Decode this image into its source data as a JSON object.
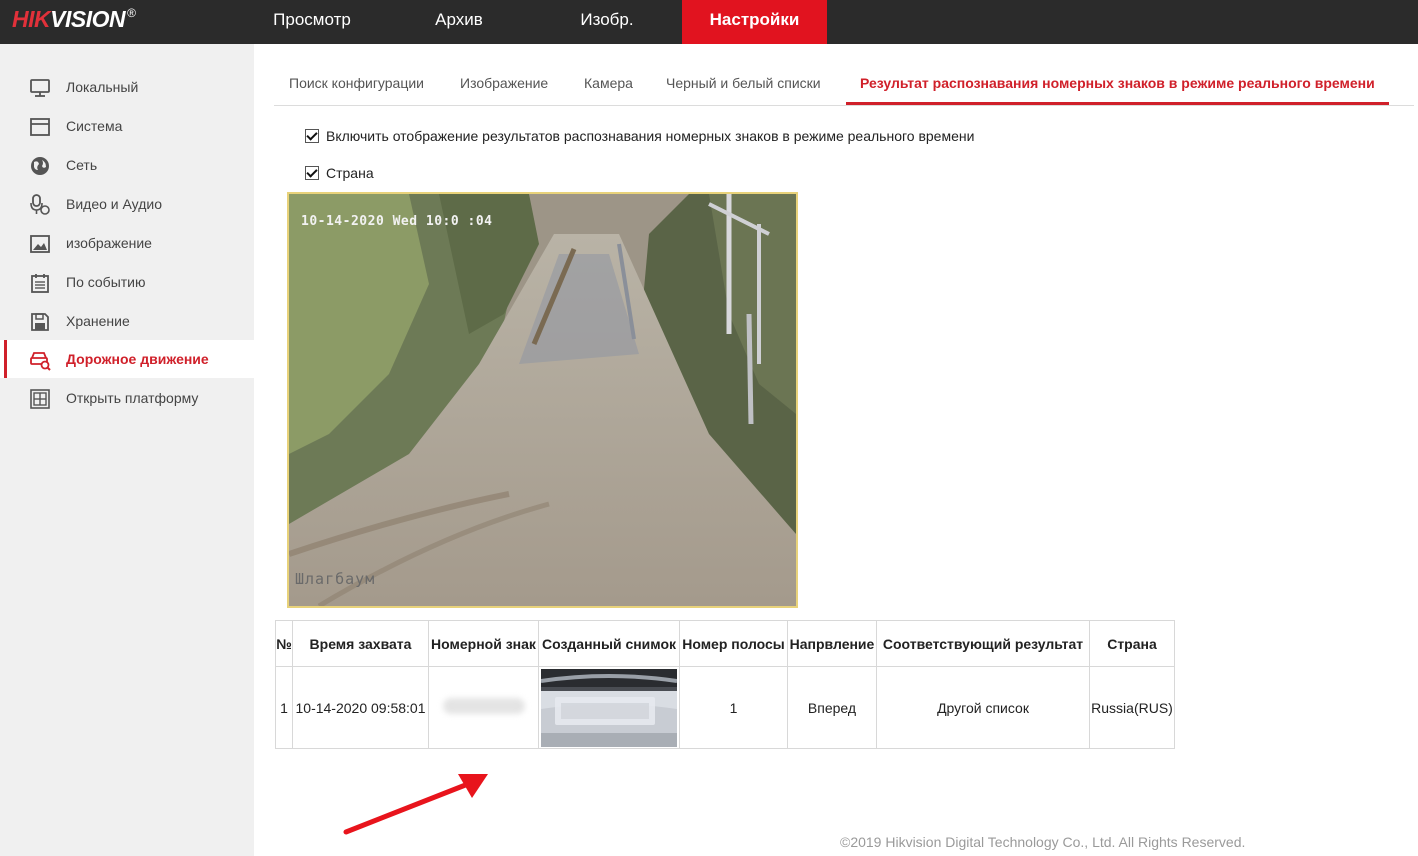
{
  "brand": {
    "logo_red": "HIK",
    "logo_white": "VISION",
    "logo_mark": "®"
  },
  "top_nav": [
    {
      "label": "Просмотр",
      "active": false
    },
    {
      "label": "Архив",
      "active": false
    },
    {
      "label": "Изобр.",
      "active": false
    },
    {
      "label": "Настройки",
      "active": true
    }
  ],
  "sidebar": {
    "items": [
      {
        "label": "Локальный",
        "icon": "monitor-icon",
        "active": false
      },
      {
        "label": "Система",
        "icon": "system-icon",
        "active": false
      },
      {
        "label": "Сеть",
        "icon": "globe-icon",
        "active": false
      },
      {
        "label": "Видео и Аудио",
        "icon": "microphone-icon",
        "active": false
      },
      {
        "label": "изображение",
        "icon": "image-icon",
        "active": false
      },
      {
        "label": "По событию",
        "icon": "calendar-icon",
        "active": false
      },
      {
        "label": "Хранение",
        "icon": "save-icon",
        "active": false
      },
      {
        "label": "Дорожное движение",
        "icon": "car-search-icon",
        "active": true
      },
      {
        "label": "Открыть платформу",
        "icon": "platform-icon",
        "active": false
      }
    ]
  },
  "tabs": [
    {
      "label": "Поиск конфигурации",
      "active": false
    },
    {
      "label": "Изображение",
      "active": false
    },
    {
      "label": "Камера",
      "active": false
    },
    {
      "label": "Черный и белый списки",
      "active": false
    },
    {
      "label": "Результат распознавания номерных знаков в режиме реального времени",
      "active": true
    }
  ],
  "options": {
    "enable_display": {
      "label": "Включить отображение результатов распознавания номерных знаков в режиме реального времени",
      "checked": true
    },
    "country": {
      "label": "Страна",
      "checked": true
    }
  },
  "camera": {
    "osd_time": "10-14-2020 Wed 10:0 :04",
    "osd_name": "Шлагбаум"
  },
  "results_table": {
    "columns": [
      "№",
      "Время захвата",
      "Номерной знак",
      "Созданный снимок",
      "Номер полосы",
      "Напрвление",
      "Соответствующий результат",
      "Страна"
    ],
    "rows": [
      {
        "no": "1",
        "time": "10-14-2020 09:58:01",
        "plate": "",
        "lane": "1",
        "direction": "Вперед",
        "result": "Другой список",
        "country": "Russia(RUS)"
      }
    ]
  },
  "footer": "©2019 Hikvision Digital Technology Co., Ltd. All Rights Reserved.",
  "colors": {
    "accent": "#e1131f",
    "topbar": "#2b2b2b",
    "sidebar": "#f0f0f0",
    "arrow": "#e8141c"
  }
}
